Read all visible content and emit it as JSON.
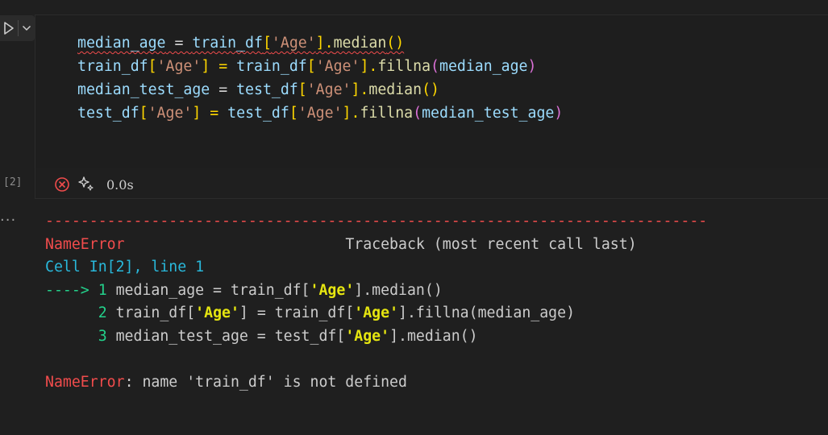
{
  "cell": {
    "execution_count": "[2]",
    "status_time": "0.0s",
    "code": [
      [
        "median_age",
        " = ",
        "train_df",
        "[",
        "'Age'",
        "].",
        "median",
        "()"
      ],
      [
        "train_df",
        "[",
        "'Age'",
        "] = ",
        "train_df",
        "[",
        "'Age'",
        "].",
        "fillna",
        "(",
        "median_age",
        ")"
      ],
      [
        "median_test_age",
        " = ",
        "test_df",
        "[",
        "'Age'",
        "].",
        "median",
        "()"
      ],
      [
        "test_df",
        "[",
        "'Age'",
        "] = ",
        "test_df",
        "[",
        "'Age'",
        "].",
        "fillna",
        "(",
        "median_test_age",
        ")"
      ]
    ]
  },
  "output": {
    "more_label": "...",
    "separator": "---------------------------------------------------------------------------",
    "error_name": "NameError",
    "traceback_spacer": "                         ",
    "traceback_label": "Traceback (most recent call last)",
    "cell_ref": "Cell In[2], line 1",
    "arrow": "----> ",
    "trace_lines": [
      {
        "num": "1",
        "parts": [
          "median_age = train_df[",
          "'Age'",
          "].median()"
        ]
      },
      {
        "num": "2",
        "parts": [
          "train_df[",
          "'Age'",
          "] = train_df[",
          "'Age'",
          "].fillna(median_age)"
        ]
      },
      {
        "num": "3",
        "parts": [
          "median_test_age = test_df[",
          "'Age'",
          "].median()"
        ]
      }
    ],
    "indent": "      ",
    "error_message": ": name 'train_df' is not defined"
  },
  "icons": {
    "run": "play-icon",
    "run_menu": "chevron-down-icon",
    "status_error": "error-circle-icon",
    "status_sparkle": "sparkle-icon"
  },
  "colors": {
    "error": "#f14c4c",
    "accent_string": "#ce9178",
    "variable": "#9cdcfe"
  }
}
